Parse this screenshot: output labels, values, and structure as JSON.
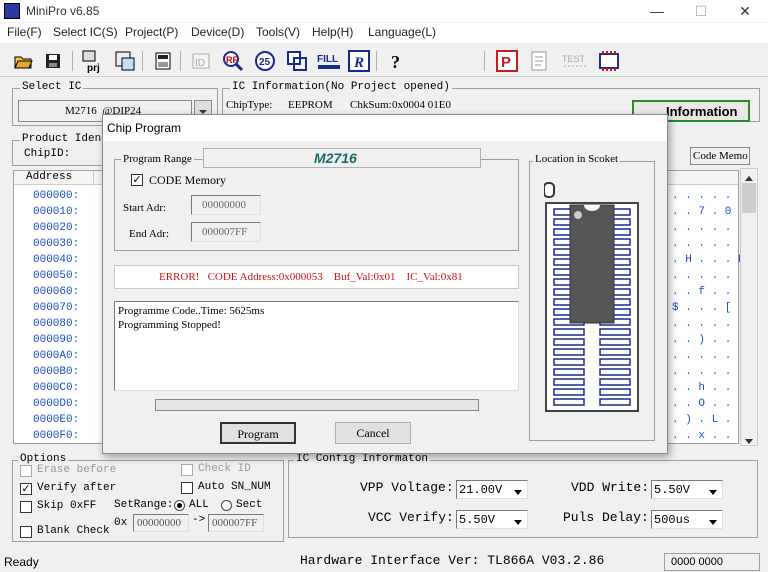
{
  "window": {
    "title": "MiniPro v6.85",
    "minimize": "—",
    "maximize": "☐",
    "close": "✕"
  },
  "menu": [
    "File(F)",
    "Select IC(S)",
    "Project(P)",
    "Device(D)",
    "Tools(V)",
    "Help(H)",
    "Language(L)"
  ],
  "select_ic": {
    "legend": "Select IC",
    "chip": "M2716  @DIP24"
  },
  "ic_info": {
    "legend": "IC Information(No Project opened)",
    "chip_type_label": "ChipType:",
    "chip_type": "EEPROM",
    "chksum_label": "ChkSum:",
    "chksum": "0x0004 01E0",
    "info_button": "Information"
  },
  "product": {
    "legend": "Product Identi",
    "chipid_label": "ChipID:",
    "code_memo": "Code Memo"
  },
  "address": {
    "header": "Address",
    "rows": [
      "000000:",
      "000010:",
      "000020:",
      "000030:",
      "000040:",
      "000050:",
      "000060:",
      "000070:",
      "000080:",
      "000090:",
      "0000A0:",
      "0000B0:",
      "0000C0:",
      "0000D0:",
      "0000E0:",
      "0000F0:"
    ],
    "ascii": [
      ". . . . .",
      ". . 7 . 0",
      ". . . . .",
      ". . . . .",
      ". H . . . H",
      ". . . . .",
      ". . f . . .",
      "$ . . . [ .",
      ". . . . .",
      ". . ) . . .",
      ". . . . .",
      ". . . . .",
      ". . h . . .",
      ". . O . . .",
      ". ) . L . .",
      ". . x . . ."
    ]
  },
  "options": {
    "legend": "Options",
    "erase_before": "Erase before",
    "verify_after": "Verify after",
    "skip_off": "Skip 0xFF",
    "blank_check": "Blank Check",
    "check_id": "Check ID",
    "auto_sn": "Auto SN_NUM",
    "setrange_label": "SetRange:",
    "all": "ALL",
    "sect": "Sect",
    "ox": "0x",
    "range_from": "00000000",
    "arrow": "->",
    "range_to": "000007FF"
  },
  "ic_config": {
    "legend": "IC Config Informaton",
    "vpp_label": "VPP Voltage:",
    "vpp": "21.00V",
    "vdd_label": "VDD Write:",
    "vdd": "5.50V",
    "vcc_label": "VCC Verify:",
    "vcc": "5.50V",
    "puls_label": "Puls Delay:",
    "puls": "500us"
  },
  "status": {
    "ready": "Ready",
    "hardware": "Hardware Interface Ver: TL866A V03.2.86",
    "counter": "0000 0000"
  },
  "dialog": {
    "title": "Chip Program",
    "program_range_legend": "Program Range",
    "device_name": "M2716",
    "code_memory": "CODE Memory",
    "start_label": "Start Adr:",
    "start": "00000000",
    "end_label": "End Adr:",
    "end": "000007FF",
    "location_legend": "Location in Scoket",
    "error": "ERROR!   CODE Address:0x000053    Buf_Val:0x01    IC_Val:0x81",
    "log_line1": "Programme Code..Time: 5625ms",
    "log_line2": "Programming Stopped!",
    "program_button": "Program",
    "cancel_button": "Cancel"
  },
  "colors": {
    "address_blue": "#1a4fd0",
    "error_red": "#d01010",
    "device_teal": "#1a6a6a"
  }
}
